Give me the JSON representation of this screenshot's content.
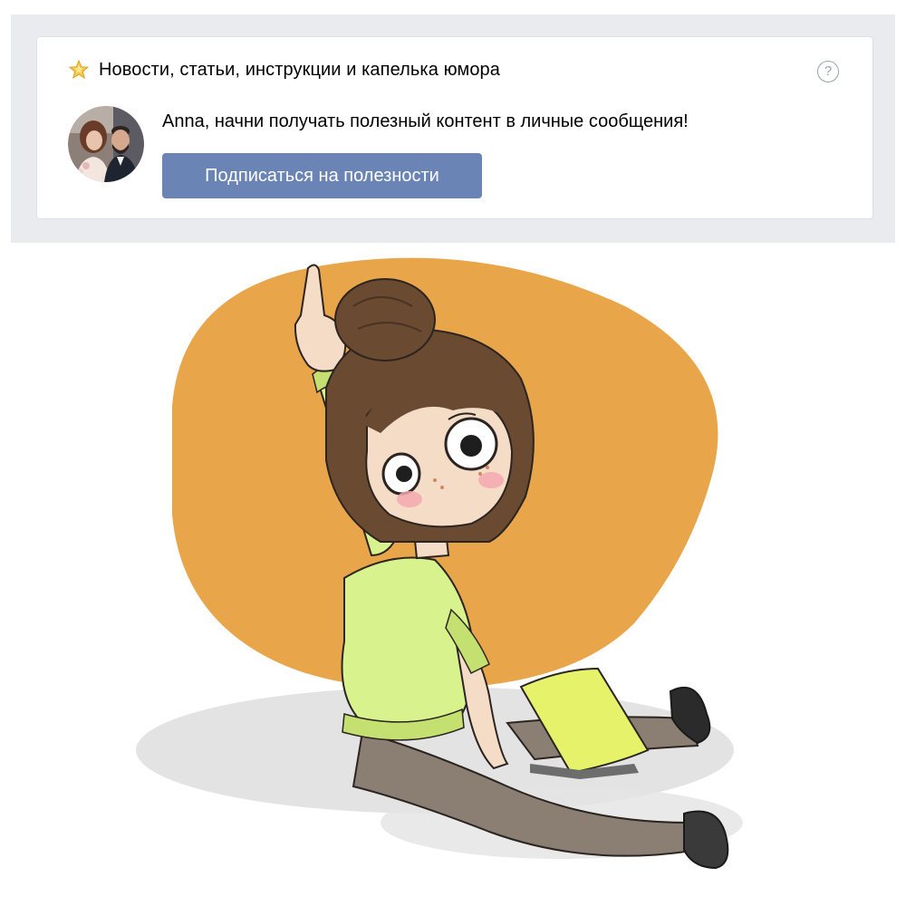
{
  "widget": {
    "title": "Новости, статьи, инструкции и капелька юмора",
    "help_symbol": "?",
    "message": "Anna, начни получать полезный контент в личные сообщения!",
    "subscribe_label": "Подписаться на полезности"
  },
  "icons": {
    "header": "star-icon",
    "help": "question-icon",
    "avatar": "avatar-photo"
  },
  "colors": {
    "band_background": "#e9ebee",
    "button_background": "#6a84b6",
    "button_text": "#ffffff",
    "illustration_blob": "#e8a54a",
    "sweater": "#d8f28e",
    "hair": "#6b4a32",
    "tablet": "#e6f36a"
  }
}
